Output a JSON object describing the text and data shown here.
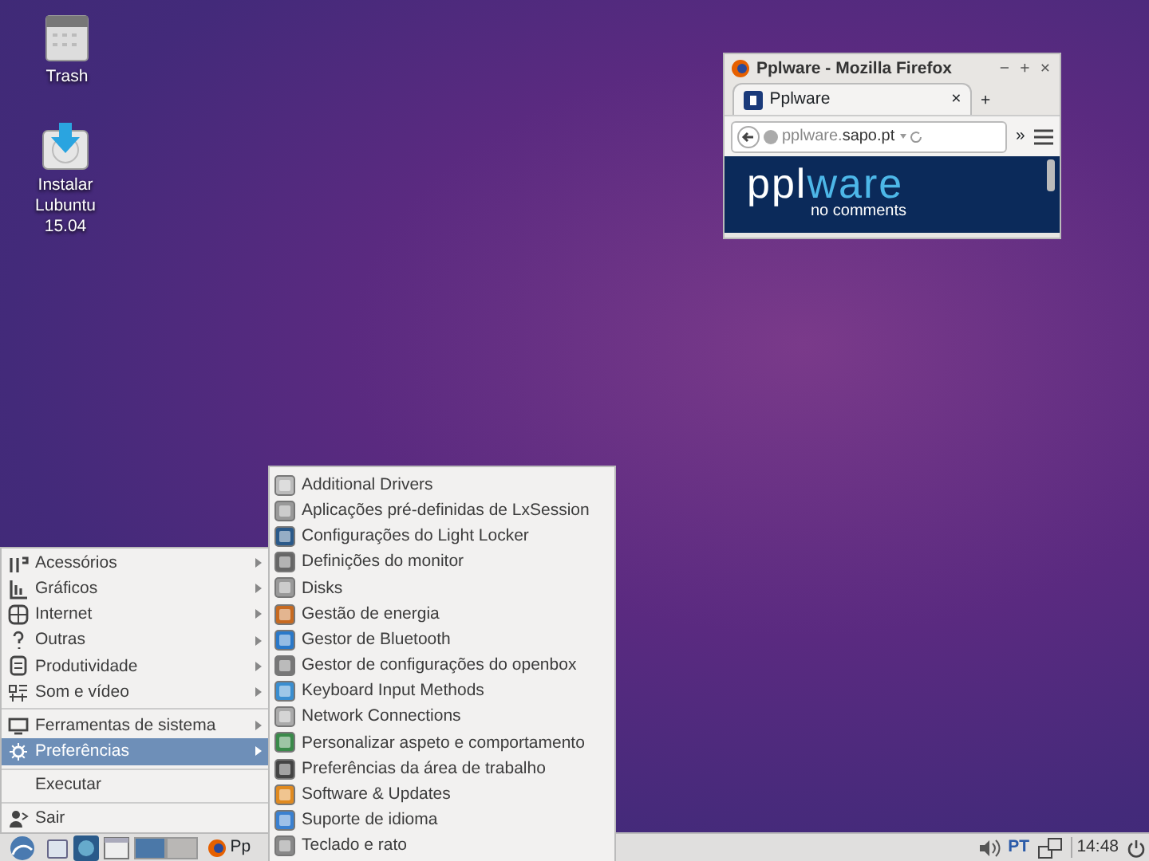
{
  "desktop_icons": [
    {
      "label": "Trash",
      "kind": "trash"
    },
    {
      "label": "Instalar Lubuntu 15.04",
      "kind": "installer"
    }
  ],
  "browser": {
    "title": "Pplware - Mozilla Firefox",
    "controls": [
      "−",
      "+",
      "×"
    ],
    "tab": {
      "label": "Pplware",
      "close": "×"
    },
    "new_tab": "+",
    "address": {
      "host_prefix": "pplware.",
      "host_main": "sapo.pt"
    },
    "overflow": "»",
    "page": {
      "logo_start": "ppl",
      "logo_end": "ware",
      "tagline": "no comments"
    }
  },
  "main_menu": [
    {
      "kind": "submenu",
      "label": "Acessórios",
      "selected": false
    },
    {
      "kind": "submenu",
      "label": "Gráficos",
      "selected": false
    },
    {
      "kind": "submenu",
      "label": "Internet",
      "selected": false
    },
    {
      "kind": "submenu",
      "label": "Outras",
      "selected": false
    },
    {
      "kind": "submenu",
      "label": "Produtividade",
      "selected": false
    },
    {
      "kind": "submenu",
      "label": "Som e vídeo",
      "selected": false
    },
    {
      "kind": "separator"
    },
    {
      "kind": "submenu",
      "label": "Ferramentas de sistema",
      "selected": false
    },
    {
      "kind": "submenu",
      "label": "Preferências",
      "selected": true
    },
    {
      "kind": "separator"
    },
    {
      "kind": "action",
      "label": "Executar",
      "selected": false
    },
    {
      "kind": "separator"
    },
    {
      "kind": "action",
      "label": "Sair",
      "selected": false
    }
  ],
  "submenu": [
    "Additional Drivers",
    "Aplicações pré-definidas de LxSession",
    "Configurações do Light Locker",
    "Definições do monitor",
    "Disks",
    "Gestão de energia",
    "Gestor de Bluetooth",
    "Gestor de configurações do openbox",
    "Keyboard Input Methods",
    "Network Connections",
    "Personalizar aspeto e comportamento",
    "Preferências da área de trabalho",
    "Software & Updates",
    "Suporte de idioma",
    "Teclado e rato"
  ],
  "taskbar": {
    "desktops": [
      {
        "selected": true
      },
      {
        "selected": false
      }
    ],
    "task_label": "Pp",
    "keyboard_layout": "PT",
    "clock": "14:48"
  }
}
